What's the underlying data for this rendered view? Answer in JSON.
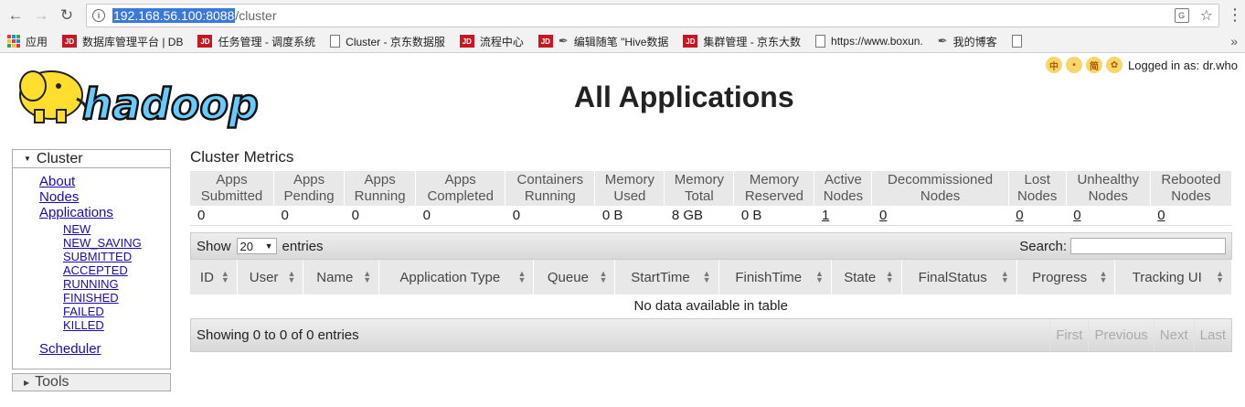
{
  "browser": {
    "url_host": "192.168.56.100:8088",
    "url_path": "/cluster",
    "translate_icon": "G"
  },
  "bookmarks": [
    {
      "label": "应用",
      "icon": "apps"
    },
    {
      "label": "数据库管理平台 | DB",
      "icon": "jd"
    },
    {
      "label": "任务管理 - 调度系统",
      "icon": "jd"
    },
    {
      "label": "Cluster - 京东数据服",
      "icon": "doc"
    },
    {
      "label": "流程中心",
      "icon": "jd"
    },
    {
      "label": "编辑随笔 \"Hive数据",
      "icon": "jd-pen"
    },
    {
      "label": "集群管理 - 京东大数",
      "icon": "jd"
    },
    {
      "label": "https://www.boxun.",
      "icon": "doc"
    },
    {
      "label": "我的博客",
      "icon": "pen"
    },
    {
      "label": "",
      "icon": "doc"
    }
  ],
  "page": {
    "title": "All Applications",
    "logo_text": "hadoop",
    "logged_in": "Logged in as: dr.who",
    "ext_icons": [
      "中",
      "•",
      "简",
      "✿"
    ]
  },
  "sidebar": {
    "cluster_label": "Cluster",
    "links": [
      "About",
      "Nodes",
      "Applications"
    ],
    "app_states": [
      "NEW",
      "NEW_SAVING",
      "SUBMITTED",
      "ACCEPTED",
      "RUNNING",
      "FINISHED",
      "FAILED",
      "KILLED"
    ],
    "scheduler": "Scheduler",
    "tools_label": "Tools"
  },
  "metrics": {
    "title": "Cluster Metrics",
    "headers": [
      [
        "Apps",
        "Submitted"
      ],
      [
        "Apps",
        "Pending"
      ],
      [
        "Apps",
        "Running"
      ],
      [
        "Apps",
        "Completed"
      ],
      [
        "Containers",
        "Running"
      ],
      [
        "Memory",
        "Used"
      ],
      [
        "Memory",
        "Total"
      ],
      [
        "Memory",
        "Reserved"
      ],
      [
        "Active",
        "Nodes"
      ],
      [
        "Decommissioned",
        "Nodes"
      ],
      [
        "Lost",
        "Nodes"
      ],
      [
        "Unhealthy",
        "Nodes"
      ],
      [
        "Rebooted",
        "Nodes"
      ]
    ],
    "values": [
      "0",
      "0",
      "0",
      "0",
      "0",
      "0 B",
      "8 GB",
      "0 B",
      "1",
      "0",
      "0",
      "0",
      "0"
    ],
    "linked": [
      false,
      false,
      false,
      false,
      false,
      false,
      false,
      false,
      true,
      true,
      true,
      true,
      true
    ]
  },
  "datatable": {
    "show_label": "Show",
    "entries_value": "20",
    "entries_label": "entries",
    "search_label": "Search:",
    "columns": [
      "ID",
      "User",
      "Name",
      "Application Type",
      "Queue",
      "StartTime",
      "FinishTime",
      "State",
      "FinalStatus",
      "Progress",
      "Tracking UI"
    ],
    "empty_message": "No data available in table",
    "info": "Showing 0 to 0 of 0 entries",
    "pager": [
      "First",
      "Previous",
      "Next",
      "Last"
    ]
  }
}
